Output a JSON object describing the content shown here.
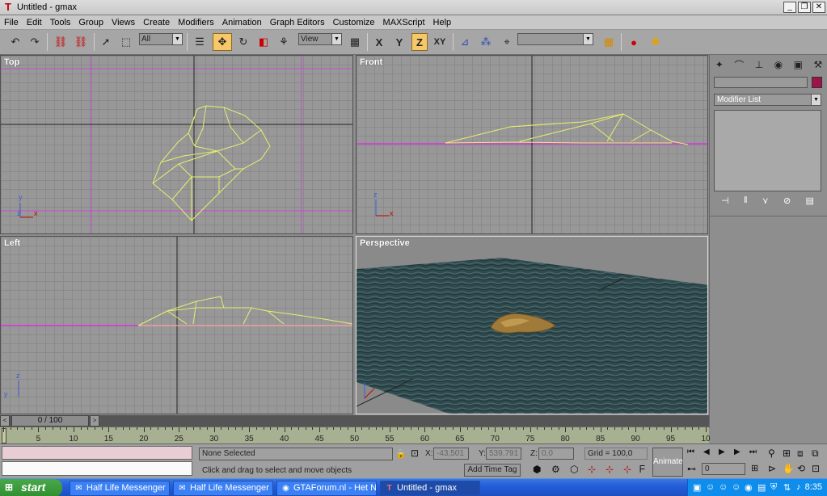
{
  "window": {
    "title": "Untitled - gmax",
    "app_icon": "gmax-logo-icon"
  },
  "menu": [
    "File",
    "Edit",
    "Tools",
    "Group",
    "Views",
    "Create",
    "Modifiers",
    "Animation",
    "Graph Editors",
    "Customize",
    "MAXScript",
    "Help"
  ],
  "toolbar": {
    "selection_filter": "All",
    "reference_coord": "View",
    "axis_x": "X",
    "axis_y": "Y",
    "axis_z": "Z",
    "axis_xy": "XY",
    "named_selection": ""
  },
  "viewports": {
    "top": "Top",
    "front": "Front",
    "left": "Left",
    "perspective": "Perspective",
    "axis_x": "x",
    "axis_y": "y",
    "axis_z": "z"
  },
  "command_panel": {
    "name_value": "",
    "object_color": "#a0134a",
    "modifier_list": "Modifier List"
  },
  "time": {
    "frame_display": "0 / 100",
    "ticks": [
      "5",
      "10",
      "15",
      "20",
      "25",
      "30",
      "35",
      "40",
      "45",
      "50",
      "55",
      "60",
      "65",
      "70",
      "75",
      "80",
      "85",
      "90",
      "95",
      "10"
    ]
  },
  "status": {
    "selection": "None Selected",
    "prompt": "Click and drag to select and move objects",
    "x_label": "X:",
    "x_value": "-43,501",
    "y_label": "Y:",
    "y_value": "539,791",
    "z_label": "Z:",
    "z_value": "0,0",
    "grid": "Grid = 100,0",
    "add_time_tag": "Add Time Tag",
    "animate": "Animate",
    "current_frame": "0"
  },
  "taskbar": {
    "start": "start",
    "tasks": [
      "Half Life Messenger",
      "Half Life Messenger",
      "GTAForum.nl - Het N...",
      "Untitled - gmax"
    ],
    "clock": "8:35"
  },
  "colors": {
    "active_tool": "#f6c86a",
    "wireframe": "#e6ee70",
    "grid_major": "#c84ccf",
    "water": "#2f4a4e"
  }
}
